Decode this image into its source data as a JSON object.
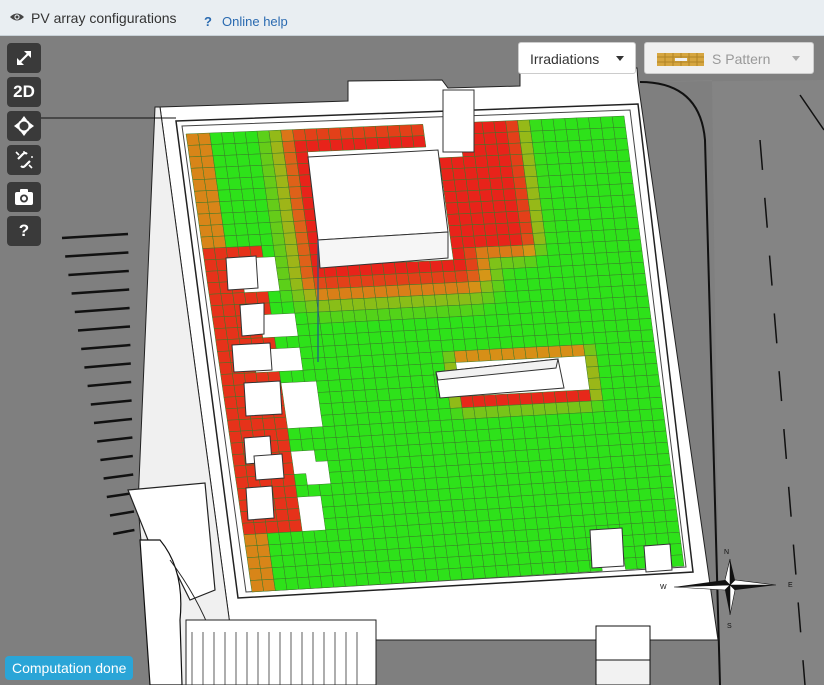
{
  "header": {
    "title": "PV array configurations",
    "help_icon_text": "?",
    "help_label": "Online help"
  },
  "toolbar": {
    "expand": {
      "icon": "expand-icon",
      "text": ""
    },
    "view_2d": {
      "label": "2D"
    },
    "center": {
      "icon": "crosshair-move-icon",
      "text": ""
    },
    "unlink": {
      "icon": "unlink-icon",
      "text": ""
    },
    "screenshot": {
      "icon": "camera-icon",
      "text": ""
    },
    "help": {
      "label": "?"
    }
  },
  "controls": {
    "layer_select": {
      "selected": "Irradiations"
    },
    "pattern_select": {
      "selected": "S Pattern",
      "disabled": true
    }
  },
  "compass": {
    "north": "N",
    "east": "E",
    "south": "S",
    "west": "W"
  },
  "status": {
    "text": "Computation done"
  },
  "colors": {
    "low_irradiation": "#e8231a",
    "medium_irradiation": "#d4a017",
    "high_irradiation": "#2ee21a",
    "status_bg": "#2aa5d7"
  }
}
